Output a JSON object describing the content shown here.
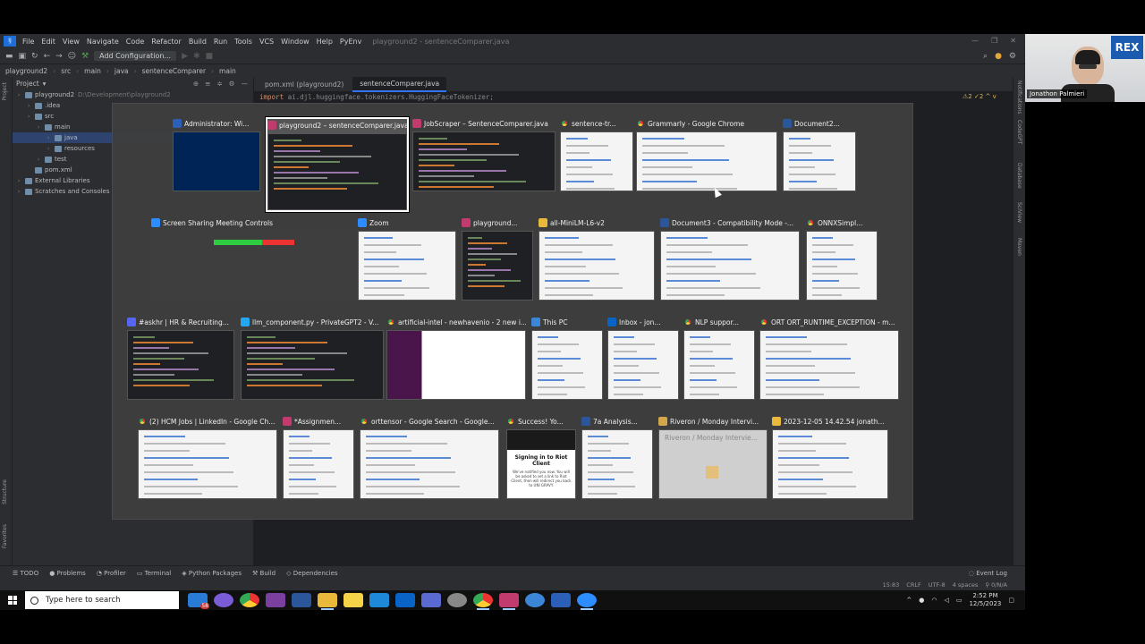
{
  "menubar": {
    "items": [
      "File",
      "Edit",
      "View",
      "Navigate",
      "Code",
      "Refactor",
      "Build",
      "Run",
      "Tools",
      "VCS",
      "Window",
      "Help",
      "PyEnv"
    ],
    "window_title": "playground2 - sentenceComparer.java"
  },
  "toolbar": {
    "config_label": "Add Configuration..."
  },
  "breadcrumb": [
    "playground2",
    "src",
    "main",
    "java",
    "sentenceComparer",
    "main"
  ],
  "project_panel": {
    "title": "Project",
    "tree": [
      {
        "label": "playground2",
        "extra": "D:\\Development\\playground2",
        "indent": 0
      },
      {
        "label": ".idea",
        "indent": 1
      },
      {
        "label": "src",
        "indent": 1
      },
      {
        "label": "main",
        "indent": 2
      },
      {
        "label": "java",
        "indent": 3,
        "selected": true
      },
      {
        "label": "resources",
        "indent": 3
      },
      {
        "label": "test",
        "indent": 2
      },
      {
        "label": "pom.xml",
        "indent": 1
      },
      {
        "label": "External Libraries",
        "indent": 0
      },
      {
        "label": "Scratches and Consoles",
        "indent": 0
      }
    ]
  },
  "editor": {
    "tabs": [
      "pom.xml (playground2)",
      "sentenceComparer.java"
    ],
    "code_kw": "import",
    "code_rest": " ai.djl.huggingface.tokenizers.HuggingFaceTokenizer;",
    "warnings": "⚠2 ✓2 ^ v"
  },
  "left_strip": [
    "Project",
    "Structure",
    "Favorites"
  ],
  "right_strip": [
    "Notifications",
    "CodeGPT",
    "Database",
    "SciView",
    "Maven"
  ],
  "bottom_tools": [
    "TODO",
    "Problems",
    "Profiler",
    "Terminal",
    "Python Packages",
    "Build",
    "Dependencies"
  ],
  "event_log": "Event Log",
  "status": [
    "15:83",
    "CRLF",
    "UTF-8",
    "4 spaces",
    "⚲ 0/N/A"
  ],
  "taskbar": {
    "search_placeholder": "Type here to search",
    "time": "2:52 PM",
    "date": "12/5/2023",
    "badge": "58"
  },
  "webcam": {
    "name": "Jonathon Palmieri",
    "logo": "REX"
  },
  "switcher": [
    {
      "title": "Administrator: Wi...",
      "icon": "#2b5fb8",
      "kind": "console"
    },
    {
      "title": "playground2 – sentenceComparer.java",
      "icon": "#c23b6e",
      "kind": "ide",
      "selected": true
    },
    {
      "title": "JobScraper – SentenceComparer.java",
      "icon": "#c23b6e",
      "kind": "ide"
    },
    {
      "title": "sentence-tr...",
      "icon": "chrome",
      "kind": "page"
    },
    {
      "title": "Grammarly - Google Chrome",
      "icon": "chrome",
      "kind": "doc"
    },
    {
      "title": "Document2...",
      "icon": "#2b579a",
      "kind": "doc"
    },
    {
      "title": "Screen Sharing Meeting Controls",
      "icon": "#2d8cff",
      "kind": "zoombar"
    },
    {
      "title": "Zoom",
      "icon": "#2d8cff",
      "kind": "page"
    },
    {
      "title": "playground...",
      "icon": "#c23b6e",
      "kind": "ide"
    },
    {
      "title": "all-MiniLM-L6-v2",
      "icon": "#e8b93a",
      "kind": "page"
    },
    {
      "title": "Document3  -  Compatibility Mode -...",
      "icon": "#2b579a",
      "kind": "doc"
    },
    {
      "title": "ONNXSimpl...",
      "icon": "chrome",
      "kind": "page"
    },
    {
      "title": "#askhr | HR & Recruiting...",
      "icon": "#5865f2",
      "kind": "ide"
    },
    {
      "title": "llm_component.py - PrivateGPT2 - V...",
      "icon": "#22a7f0",
      "kind": "ide"
    },
    {
      "title": "artificial-intel - newhavenio - 2 new i...",
      "icon": "chrome",
      "kind": "slack"
    },
    {
      "title": "This PC",
      "icon": "#3b86d6",
      "kind": "page"
    },
    {
      "title": "Inbox - jon...",
      "icon": "#0a64c8",
      "kind": "page"
    },
    {
      "title": "NLP suppor...",
      "icon": "chrome",
      "kind": "page"
    },
    {
      "title": "ORT ORT_RUNTIME_EXCEPTION - m...",
      "icon": "chrome",
      "kind": "page"
    },
    {
      "title": "(2) HCM Jobs | LinkedIn - Google Ch...",
      "icon": "chrome",
      "kind": "page"
    },
    {
      "title": "*Assignmen...",
      "icon": "#c23b6e",
      "kind": "page"
    },
    {
      "title": "orttensor - Google Search - Google...",
      "icon": "chrome",
      "kind": "page"
    },
    {
      "title": "Success! Yo...",
      "icon": "chrome",
      "kind": "riot",
      "riot_title": "Signing in to Riot Client",
      "riot_body": "We've notified you now. You will be asked to set a link to Riot Client, then will redirect you back to UNI GRAVY."
    },
    {
      "title": "7a Analysis...",
      "icon": "#2b579a",
      "kind": "doc"
    },
    {
      "title": "Riveron / Monday Intervi...",
      "icon": "#d4a84a",
      "kind": "riveron",
      "inner": "Riveron / Monday Intervie..."
    },
    {
      "title": "2023-12-05 14.42.54 jonath...",
      "icon": "#e8b93a",
      "kind": "page"
    }
  ]
}
